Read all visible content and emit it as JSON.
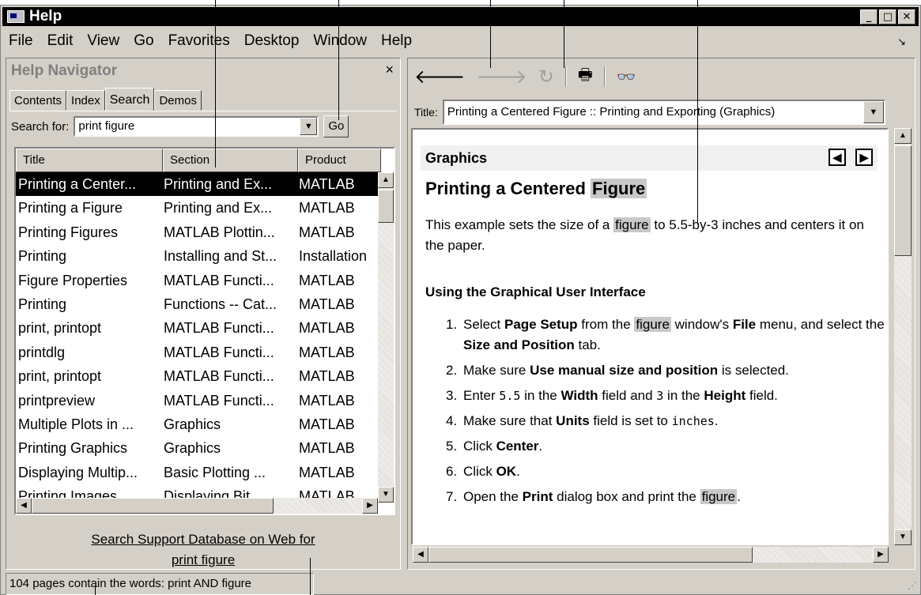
{
  "window": {
    "title": "Help"
  },
  "menubar": {
    "items": [
      "File",
      "Edit",
      "View",
      "Go",
      "Favorites",
      "Desktop",
      "Window",
      "Help"
    ]
  },
  "navigator": {
    "title": "Help Navigator",
    "close_label": "×",
    "tabs": [
      "Contents",
      "Index",
      "Search",
      "Demos"
    ],
    "active_tab": "Search",
    "search_label": "Search for:",
    "search_value": "print figure",
    "go_label": "Go",
    "columns": [
      "Title",
      "Section",
      "Product"
    ],
    "rows": [
      [
        "Printing a Center...",
        "Printing and Ex...",
        "MATLAB"
      ],
      [
        "Printing a Figure",
        "Printing and Ex...",
        "MATLAB"
      ],
      [
        "Printing Figures",
        "MATLAB Plottin...",
        "MATLAB"
      ],
      [
        "Printing",
        "Installing and St...",
        "Installation"
      ],
      [
        "Figure Properties",
        "MATLAB Functi...",
        "MATLAB"
      ],
      [
        "Printing",
        "Functions -- Cat...",
        "MATLAB"
      ],
      [
        "print, printopt",
        "MATLAB Functi...",
        "MATLAB"
      ],
      [
        "printdlg",
        "MATLAB Functi...",
        "MATLAB"
      ],
      [
        "print, printopt",
        "MATLAB Functi...",
        "MATLAB"
      ],
      [
        "printpreview",
        "MATLAB Functi...",
        "MATLAB"
      ],
      [
        "Multiple Plots in ...",
        "Graphics",
        "MATLAB"
      ],
      [
        "Printing Graphics",
        "Graphics",
        "MATLAB"
      ],
      [
        "Displaying Multip...",
        "Basic Plotting ...",
        "MATLAB"
      ],
      [
        "Printing Images",
        "Displaying Bit...",
        "MATLAB"
      ]
    ],
    "selected_row": 0,
    "web_link_line1": "Search Support Database on Web for",
    "web_link_line2": "print figure"
  },
  "viewer": {
    "title_label": "Title:",
    "title_value": "Printing a Centered Figure :: Printing and Exporting (Graphics)",
    "band_title": "Graphics",
    "heading": "Printing a Centered ",
    "heading_highlight": "Figure",
    "intro_before": "This example sets the size of a ",
    "intro_highlight": "figure",
    "intro_after": " to 5.5-by-3 inches and centers it on the paper.",
    "subheading": "Using the Graphical User Interface",
    "steps": [
      {
        "num": "1.",
        "html": "Select <b>Page Setup</b> from the <span class='hl'>figure</span> window's <b>File</b> menu, and select the <b>Size and Position</b> tab."
      },
      {
        "num": "2.",
        "html": "Make sure <b>Use manual size and position</b> is selected."
      },
      {
        "num": "3.",
        "html": "Enter <span class='mono'>5.5</span> in the <b>Width</b> field and <span class='mono'>3</span> in the <b>Height</b> field."
      },
      {
        "num": "4.",
        "html": "Make sure that <b>Units</b> field is set to <span class='mono'>inches</span>."
      },
      {
        "num": "5.",
        "html": "Click <b>Center</b>."
      },
      {
        "num": "6.",
        "html": "Click <b>OK</b>."
      },
      {
        "num": "7.",
        "html": "Open the <b>Print</b> dialog box and print the <span class='hl'>figure</span>."
      }
    ]
  },
  "status": {
    "text": "104 pages contain the words: print AND figure"
  }
}
